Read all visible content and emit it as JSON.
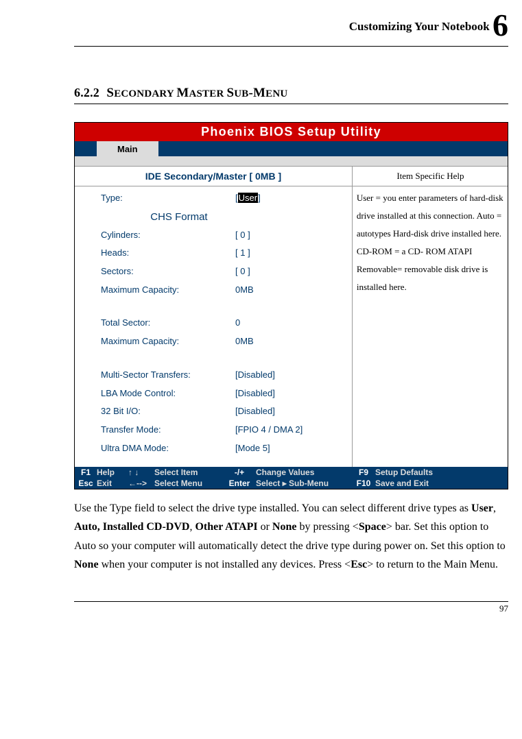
{
  "header": {
    "title": "Customizing Your Notebook",
    "chapter": "6"
  },
  "section": {
    "number": "6.2.2",
    "title_caps1": "S",
    "title_sub1": "ECONDARY ",
    "title_caps2": "M",
    "title_sub2": "ASTER ",
    "title_caps3": "S",
    "title_sub3": "UB",
    "hyphen": "-",
    "title_caps4": "M",
    "title_sub4": "ENU"
  },
  "bios": {
    "title": "Phoenix BIOS Setup Utility",
    "main_tab": "Main",
    "sub_header": "IDE Secondary/Master  [ 0MB ]",
    "help_label": "Item Specific Help",
    "chs_format": "CHS Format",
    "rows": {
      "type_label": "Type:",
      "type_bracket_open": "[",
      "type_value": "User",
      "type_bracket_close": "]",
      "cylinders_label": "Cylinders:",
      "cylinders_value": "[ 0 ]",
      "heads_label": "Heads:",
      "heads_value": "[ 1 ]",
      "sectors_label": "Sectors:",
      "sectors_value": "[ 0 ]",
      "maxcap1_label": "Maximum Capacity:",
      "maxcap1_value": "0MB",
      "totalsec_label": "Total Sector:",
      "totalsec_value": "0",
      "maxcap2_label": "Maximum Capacity:",
      "maxcap2_value": "0MB",
      "mst_label": "Multi-Sector Transfers:",
      "mst_value": "[Disabled]",
      "lba_label": "LBA Mode Control:",
      "lba_value": "[Disabled]",
      "bit32_label": "32 Bit I/O:",
      "bit32_value": "[Disabled]",
      "tmode_label": "Transfer Mode:",
      "tmode_value": "[FPIO 4 / DMA 2]",
      "udma_label": "Ultra DMA Mode:",
      "udma_value": "[Mode 5]"
    },
    "help_text": "User = you enter parameters of hard-disk drive installed at this connection.\nAuto = autotypes Hard-disk drive installed here.\nCD-ROM = a CD- ROM ATAPI Removable= removable disk drive is installed here.",
    "footer": {
      "f1": "F1",
      "help": "Help",
      "arrows_ud": "↑ ↓",
      "select_item": "Select Item",
      "pm": "-/+",
      "change_values": "Change Values",
      "f9": "F9",
      "setup_defaults": "Setup Defaults",
      "esc": "Esc",
      "exit": "Exit",
      "arrows_lr": "←-->",
      "select_menu": "Select Menu",
      "enter": "Enter",
      "select_submenu": "Select ▸ Sub-Menu",
      "f10": "F10",
      "save_exit": "Save and Exit"
    }
  },
  "body": {
    "p1a": "Use the Type field to select the drive type installed. You can select different drive types as ",
    "b1": "User",
    "c1": ", ",
    "b2": "Auto, Installed CD-DVD",
    "c2": ", ",
    "b3": "Other ATAPI",
    "c3": " or ",
    "b4": "None",
    "p1b": " by pressing <",
    "b5": "Space",
    "p1c": "> bar. Set this option to Auto so your computer will automatically detect the drive type during power on. Set this option to ",
    "b6": "None",
    "p1d": " when your computer is not installed any devices. Press <",
    "b7": "Esc",
    "p1e": "> to return to the Main Menu."
  },
  "page_number": "97"
}
